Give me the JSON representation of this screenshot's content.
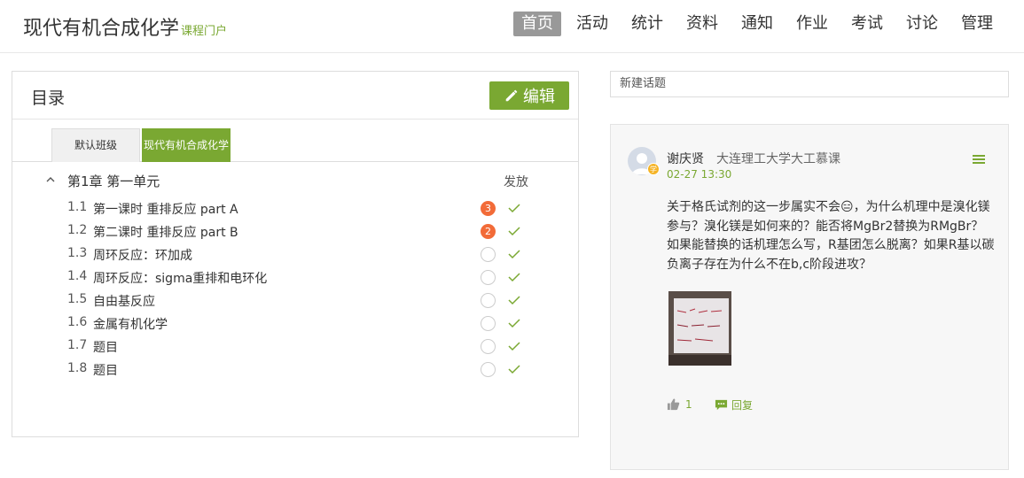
{
  "header": {
    "title": "现代有机合成化学",
    "subtitle": "课程门户",
    "nav": [
      "首页",
      "活动",
      "统计",
      "资料",
      "通知",
      "作业",
      "考试",
      "讨论",
      "管理"
    ],
    "active_index": 0
  },
  "catalog": {
    "title": "目录",
    "edit_label": "编辑",
    "tabs": [
      "默认班级",
      "现代有机合成化学"
    ],
    "chapter_title": "第1章 第一单元",
    "column_label": "发放",
    "lessons": [
      {
        "num": "1.1",
        "title": "第一课时 重排反应 part A",
        "badge": "3"
      },
      {
        "num": "1.2",
        "title": "第二课时 重排反应 part B",
        "badge": "2"
      },
      {
        "num": "1.3",
        "title": "周环反应：环加成",
        "badge": ""
      },
      {
        "num": "1.4",
        "title": "周环反应：sigma重排和电环化",
        "badge": ""
      },
      {
        "num": "1.5",
        "title": "自由基反应",
        "badge": ""
      },
      {
        "num": "1.6",
        "title": "金属有机化学",
        "badge": ""
      },
      {
        "num": "1.7",
        "title": "题目",
        "badge": ""
      },
      {
        "num": "1.8",
        "title": "题目",
        "badge": ""
      }
    ]
  },
  "topic": {
    "placeholder": "新建话题"
  },
  "post": {
    "author": "谢庆贤",
    "school": "大连理工大学大工慕课",
    "role_badge": "学",
    "time": "02-27 13:30",
    "body": "关于格氏试剂的这一步属实不会😑，为什么机理中是溴化镁参与？溴化镁是如何来的？能否将MgBr2替换为RMgBr？如果能替换的话机理怎么写，R基团怎么脱离？如果R基以碳负离子存在为什么不在b,c阶段进攻？",
    "likes": "1",
    "reply_label": "回复"
  },
  "colors": {
    "accent": "#7aa832",
    "badge": "#f26b38"
  }
}
